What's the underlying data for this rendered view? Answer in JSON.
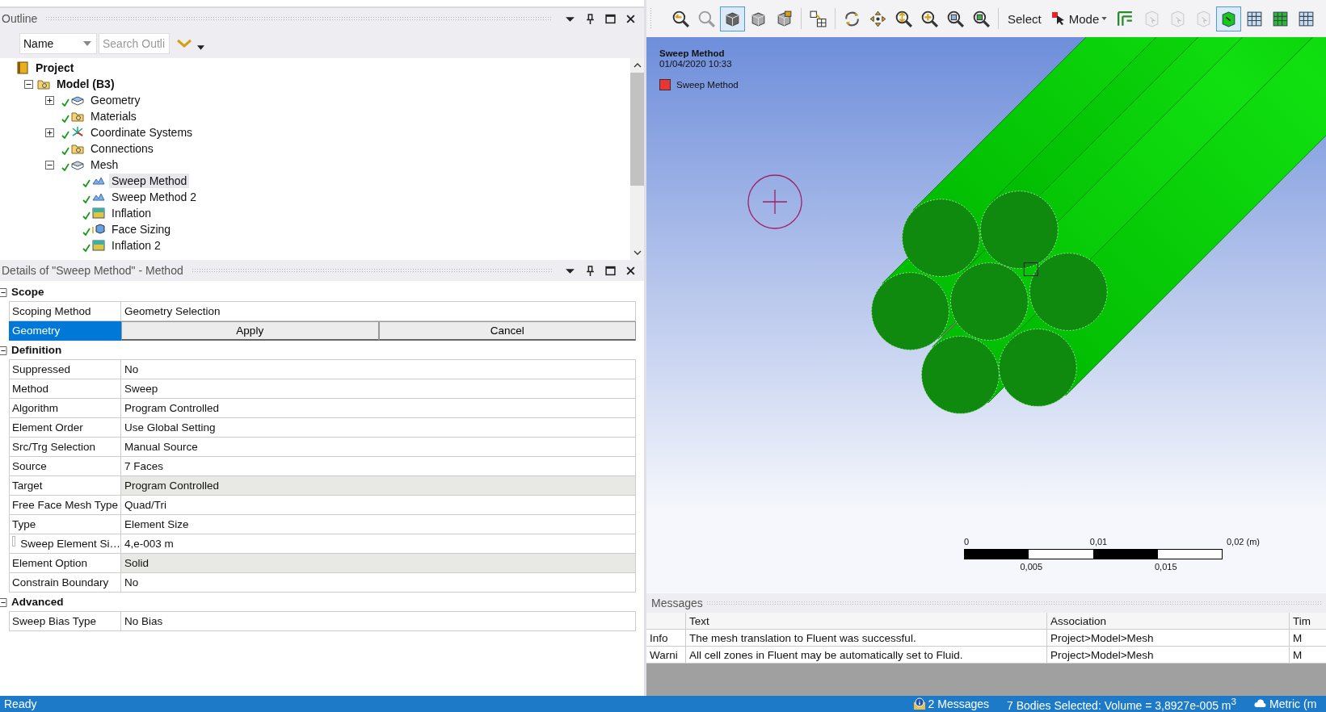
{
  "outline": {
    "title": "Outline",
    "filter": {
      "value": "Name"
    },
    "search": {
      "placeholder": "Search Outli"
    },
    "tree": [
      {
        "label": "Project",
        "kind": "project",
        "bold": true,
        "children": [
          {
            "label": "Model (B3)",
            "kind": "model",
            "bold": true,
            "expanded": true,
            "children": [
              {
                "label": "Geometry",
                "kind": "geometry",
                "checked": true,
                "expanded": false
              },
              {
                "label": "Materials",
                "kind": "folder",
                "checked": true
              },
              {
                "label": "Coordinate Systems",
                "kind": "coords",
                "checked": true,
                "expanded": false
              },
              {
                "label": "Connections",
                "kind": "folder",
                "checked": true
              },
              {
                "label": "Mesh",
                "kind": "mesh",
                "checked": true,
                "expanded": true,
                "children": [
                  {
                    "label": "Sweep Method",
                    "kind": "method",
                    "checked": true,
                    "selected": true
                  },
                  {
                    "label": "Sweep Method 2",
                    "kind": "method",
                    "checked": true,
                    "selected": false
                  },
                  {
                    "label": "Inflation",
                    "kind": "inflation",
                    "checked": true,
                    "selected": false
                  },
                  {
                    "label": "Face Sizing",
                    "kind": "sizing",
                    "checked": true,
                    "selected": false
                  },
                  {
                    "label": "Inflation 2",
                    "kind": "inflation",
                    "checked": true,
                    "selected": false
                  }
                ]
              }
            ]
          }
        ]
      }
    ]
  },
  "details": {
    "title": "Details of \"Sweep Method\" - Method",
    "rows": [
      {
        "kind": "group",
        "label": "Scope",
        "expanded": true
      },
      {
        "kind": "row",
        "label": "Scoping Method",
        "value": "Geometry Selection"
      },
      {
        "kind": "buttons",
        "label": "Geometry",
        "selected": true,
        "buttons": [
          "Apply",
          "Cancel"
        ]
      },
      {
        "kind": "group",
        "label": "Definition",
        "expanded": true
      },
      {
        "kind": "row",
        "label": "Suppressed",
        "value": "No"
      },
      {
        "kind": "row",
        "label": "Method",
        "value": "Sweep"
      },
      {
        "kind": "row",
        "label": "Algorithm",
        "value": "Program Controlled"
      },
      {
        "kind": "row",
        "label": "Element Order",
        "value": "Use Global Setting"
      },
      {
        "kind": "row",
        "label": "Src/Trg Selection",
        "value": "Manual Source"
      },
      {
        "kind": "row",
        "label": "Source",
        "value": "7 Faces"
      },
      {
        "kind": "row",
        "label": "Target",
        "value": "Program Controlled",
        "readonly": true
      },
      {
        "kind": "row",
        "label": "Free Face Mesh Type",
        "value": "Quad/Tri"
      },
      {
        "kind": "row",
        "label": "Type",
        "value": "Element Size"
      },
      {
        "kind": "check",
        "label": "Sweep Element Si…",
        "value": "4,e-003 m",
        "checked": false
      },
      {
        "kind": "row",
        "label": "Element Option",
        "value": "Solid",
        "readonly": true
      },
      {
        "kind": "row",
        "label": "Constrain Boundary",
        "value": "No"
      },
      {
        "kind": "group",
        "label": "Advanced",
        "expanded": true
      },
      {
        "kind": "row",
        "label": "Sweep Bias Type",
        "value": "No Bias"
      }
    ]
  },
  "toolbar": [
    {
      "kind": "icon",
      "selected": false,
      "disabled": false
    },
    {
      "kind": "icon",
      "selected": false,
      "disabled": true
    },
    {
      "kind": "icon",
      "selected": true,
      "disabled": false
    },
    {
      "kind": "icon",
      "selected": false,
      "disabled": false
    },
    {
      "kind": "icon",
      "selected": false,
      "disabled": false
    },
    {
      "kind": "separator"
    },
    {
      "kind": "icon",
      "selected": false,
      "disabled": false
    },
    {
      "kind": "separator"
    },
    {
      "kind": "icon",
      "selected": false,
      "disabled": false
    },
    {
      "kind": "icon",
      "selected": false,
      "disabled": false
    },
    {
      "kind": "icon",
      "selected": false,
      "disabled": false
    },
    {
      "kind": "icon",
      "selected": false,
      "disabled": false
    },
    {
      "kind": "icon",
      "selected": false,
      "disabled": false
    },
    {
      "kind": "icon",
      "selected": false,
      "disabled": false
    },
    {
      "kind": "separator"
    },
    {
      "kind": "text",
      "label": "Select"
    },
    {
      "kind": "menu",
      "label": "Mode"
    },
    {
      "kind": "icon",
      "selected": false,
      "disabled": false
    },
    {
      "kind": "icon",
      "selected": false,
      "disabled": true
    },
    {
      "kind": "icon",
      "selected": false,
      "disabled": true
    },
    {
      "kind": "icon",
      "selected": false,
      "disabled": true
    },
    {
      "kind": "icon",
      "selected": true,
      "disabled": false
    },
    {
      "kind": "icon",
      "selected": false,
      "disabled": false
    },
    {
      "kind": "icon",
      "selected": false,
      "disabled": false
    },
    {
      "kind": "icon",
      "selected": false,
      "disabled": false
    }
  ],
  "viewport": {
    "title": "Sweep Method",
    "timestamp": "01/04/2020 10:33",
    "legend": [
      {
        "label": "Sweep Method",
        "color": "#ee3333"
      }
    ],
    "scale_bar": {
      "top_labels": [
        "0",
        "0,01",
        "0,02 (m)"
      ],
      "bottom_labels": [
        "0,005",
        "0,015"
      ]
    }
  },
  "messages": {
    "title": "Messages",
    "columns": [
      "Text",
      "Association",
      "Tim"
    ],
    "rows": [
      {
        "type": "Info",
        "text": "The mesh translation to Fluent was successful.",
        "association": "Project>Model>Mesh",
        "time": "M"
      },
      {
        "type": "Warni",
        "text": "All cell zones in Fluent may be automatically set to Fluid.",
        "association": "Project>Model>Mesh",
        "time": "M"
      }
    ]
  },
  "status_bar": {
    "state": "Ready",
    "messages": "2 Messages",
    "selection": "7 Bodies Selected: Volume = 3,8927e-005 m$^{3}$",
    "units": "Metric (m"
  }
}
